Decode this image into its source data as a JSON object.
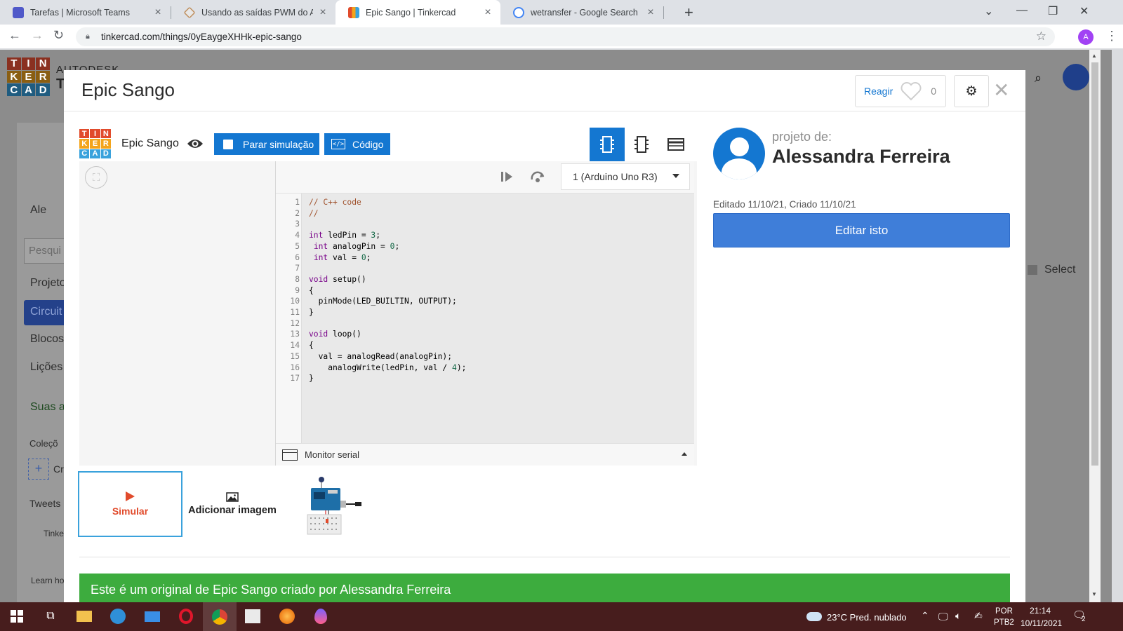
{
  "browser": {
    "tabs": [
      {
        "title": "Tarefas | Microsoft Teams",
        "icon": "teams-icon",
        "active": false
      },
      {
        "title": "Usando as saídas PWM do Arduin",
        "icon": "blog-icon",
        "active": false
      },
      {
        "title": "Epic Sango | Tinkercad",
        "icon": "tinkercad-icon",
        "active": true
      },
      {
        "title": "wetransfer - Google Search",
        "icon": "google-icon",
        "active": false
      }
    ],
    "url": "tinkercad.com/things/0yEaygeXHHk-epic-sango",
    "profile_initial": "A"
  },
  "background_page": {
    "brand_line1": "AUTODESK",
    "brand_line2": "T",
    "sidebar_name": "Ale",
    "search_placeholder": "Pesqui",
    "menu": [
      "Projeto",
      "Circuit",
      "Blocos",
      "Lições"
    ],
    "suas": "Suas a",
    "colecoes": "Coleçõ",
    "criar": "Cr",
    "tweets": "Tweets",
    "tinker": "Tinke",
    "learn": "Learn ho",
    "select_label": "Select"
  },
  "modal": {
    "title": "Epic Sango",
    "react_label": "Reagir",
    "react_count": "0",
    "designer": {
      "design_name": "Epic Sango",
      "stop_label": "Parar simulação",
      "code_label": "Código",
      "board_select": "1 (Arduino Uno R3)",
      "serial_label": "Monitor serial"
    },
    "code_lines": [
      {
        "n": "1",
        "segments": [
          {
            "t": "// C++ code",
            "c": "com"
          }
        ]
      },
      {
        "n": "2",
        "segments": [
          {
            "t": "//",
            "c": "com"
          }
        ]
      },
      {
        "n": "3",
        "segments": []
      },
      {
        "n": "4",
        "segments": [
          {
            "t": "int",
            "c": "kw"
          },
          {
            "t": " ledPin = ",
            "c": ""
          },
          {
            "t": "3",
            "c": "num"
          },
          {
            "t": ";",
            "c": ""
          }
        ]
      },
      {
        "n": "5",
        "segments": [
          {
            "t": " ",
            "c": ""
          },
          {
            "t": "int",
            "c": "kw"
          },
          {
            "t": " analogPin = ",
            "c": ""
          },
          {
            "t": "0",
            "c": "num"
          },
          {
            "t": ";",
            "c": ""
          }
        ]
      },
      {
        "n": "6",
        "segments": [
          {
            "t": " ",
            "c": ""
          },
          {
            "t": "int",
            "c": "kw"
          },
          {
            "t": " val = ",
            "c": ""
          },
          {
            "t": "0",
            "c": "num"
          },
          {
            "t": ";",
            "c": ""
          }
        ]
      },
      {
        "n": "7",
        "segments": []
      },
      {
        "n": "8",
        "segments": [
          {
            "t": "void",
            "c": "kw"
          },
          {
            "t": " setup()",
            "c": ""
          }
        ]
      },
      {
        "n": "9",
        "segments": [
          {
            "t": "{",
            "c": ""
          }
        ]
      },
      {
        "n": "10",
        "segments": [
          {
            "t": "  pinMode(LED_BUILTIN, OUTPUT);",
            "c": ""
          }
        ]
      },
      {
        "n": "11",
        "segments": [
          {
            "t": "}",
            "c": ""
          }
        ]
      },
      {
        "n": "12",
        "segments": []
      },
      {
        "n": "13",
        "segments": [
          {
            "t": "void",
            "c": "kw"
          },
          {
            "t": " loop()",
            "c": ""
          }
        ]
      },
      {
        "n": "14",
        "segments": [
          {
            "t": "{",
            "c": ""
          }
        ]
      },
      {
        "n": "15",
        "segments": [
          {
            "t": "  val = analogRead(analogPin);",
            "c": ""
          }
        ]
      },
      {
        "n": "16",
        "segments": [
          {
            "t": "    analogWrite(ledPin, val / ",
            "c": ""
          },
          {
            "t": "4",
            "c": "num"
          },
          {
            "t": ");",
            "c": ""
          }
        ]
      },
      {
        "n": "17",
        "segments": [
          {
            "t": "}",
            "c": ""
          }
        ]
      }
    ],
    "thumbnails": {
      "simulate": "Simular",
      "add_image": "Adicionar imagem"
    },
    "author": {
      "by_label": "projeto de:",
      "name": "Alessandra Ferreira",
      "dates": "Editado 11/10/21, Criado 11/10/21",
      "edit_label": "Editar isto"
    },
    "banner": "Este é um original de Epic Sango criado por Alessandra Ferreira"
  },
  "taskbar": {
    "weather": "23°C  Pred. nublado",
    "lang1": "POR",
    "lang2": "PTB2",
    "time": "21:14",
    "date": "10/11/2021",
    "notifications": "2"
  }
}
